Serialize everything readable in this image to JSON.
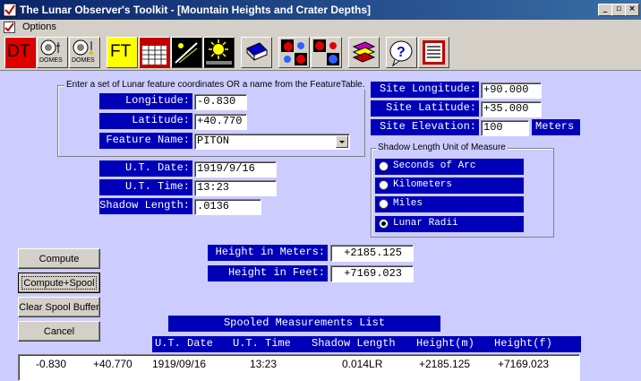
{
  "window": {
    "title": "The Lunar Observer's Toolkit - [Mountain Heights and Crater Depths]"
  },
  "menu": {
    "options": "Options"
  },
  "toolbar": {
    "dt": "DT",
    "ft": "FT",
    "domes": "DOMES"
  },
  "feature_group": {
    "caption": "Enter a set of Lunar feature coordinates OR a name from the FeatureTable.",
    "longitude_label": "Longitude:",
    "longitude_value": "-0.830",
    "latitude_label": "Latitude:",
    "latitude_value": "+40.770",
    "feature_name_label": "Feature Name:",
    "feature_name_value": "PITON"
  },
  "observation": {
    "ut_date_label": "U.T. Date:",
    "ut_date_value": "1919/9/16",
    "ut_time_label": "U.T. Time:",
    "ut_time_value": "13:23",
    "shadow_length_label": "Shadow Length:",
    "shadow_length_value": ".0136"
  },
  "site": {
    "longitude_label": "Site Longitude:",
    "longitude_value": "+90.000",
    "latitude_label": "Site Latitude:",
    "latitude_value": "+35.000",
    "elevation_label": "Site Elevation:",
    "elevation_value": "100",
    "elevation_unit": "Meters"
  },
  "shadow_unit": {
    "caption": "Shadow Length Unit of Measure",
    "options": [
      "Seconds of Arc",
      "Kilometers",
      "Miles",
      "Lunar Radii"
    ],
    "selected": "Lunar Radii"
  },
  "results": {
    "meters_label": "Height in Meters:",
    "meters_value": "+2185.125",
    "feet_label": "Height in Feet:",
    "feet_value": "+7169.023"
  },
  "buttons": {
    "compute": "Compute",
    "compute_spool": "Compute+Spool",
    "clear_spool": "Clear Spool Buffer",
    "cancel": "Cancel"
  },
  "spool": {
    "title": "Spooled Measurements List",
    "headers": [
      "U.T. Date",
      "U.T. Time",
      "Shadow Length",
      "Height(m)",
      "Height(f)"
    ],
    "rows": [
      [
        "-0.830",
        "+40.770",
        "1919/09/16",
        "13:23",
        "0.014LR",
        "+2185.125",
        "+7169.023"
      ]
    ]
  }
}
